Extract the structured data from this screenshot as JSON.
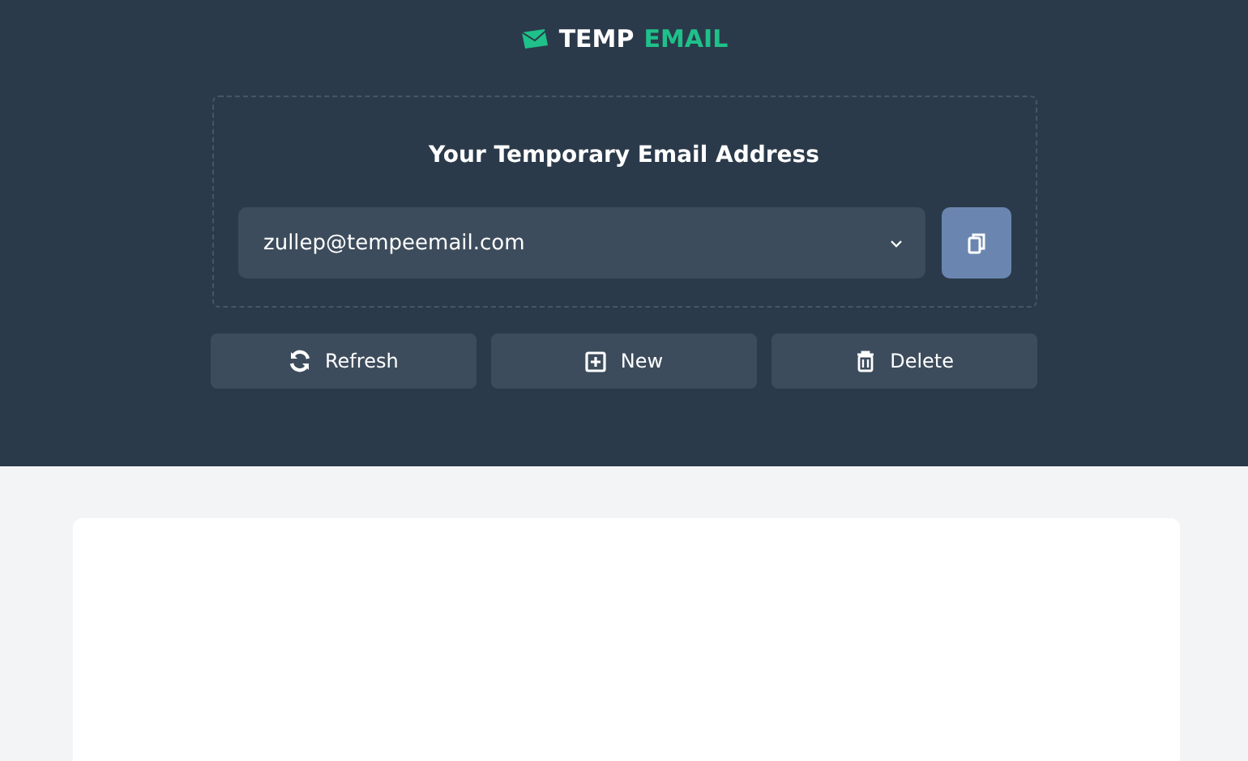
{
  "logo": {
    "word_1": "TEMP",
    "word_2": "EMAIL"
  },
  "address_panel": {
    "title": "Your Temporary Email Address",
    "email_select": {
      "value": "zullep@tempeemail.com"
    }
  },
  "actions": [
    {
      "kind": "refresh",
      "label": "Refresh"
    },
    {
      "kind": "new",
      "label": "New"
    },
    {
      "kind": "delete",
      "label": "Delete"
    }
  ]
}
